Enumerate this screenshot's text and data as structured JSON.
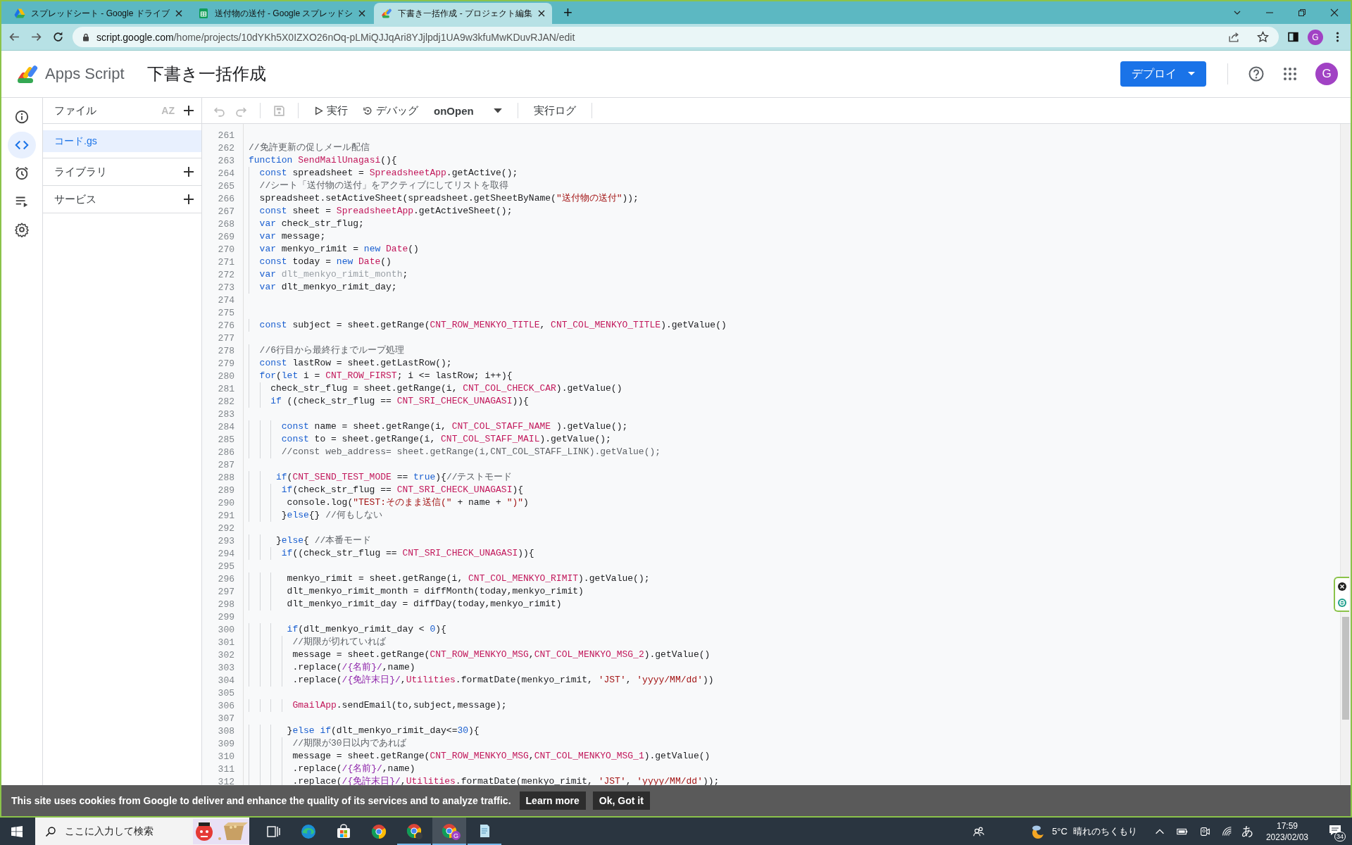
{
  "browser": {
    "tabs": [
      {
        "kind": "drive",
        "title": "スプレッドシート - Google ドライブ",
        "selected": false
      },
      {
        "kind": "sheets",
        "title": "送付物の送付 - Google スプレッドシ",
        "selected": false
      },
      {
        "kind": "apps-script",
        "title": "下書き一括作成 - プロジェクト編集",
        "selected": true
      }
    ],
    "new_tab": "+",
    "address": {
      "host": "script.google.com",
      "path": "/home/projects/10dYKh5X0IZXO26nOq-pLMiQJJqAri8YJjlpdj1UA9w3kfuMwKDuvRJAN/edit"
    },
    "profile": "G"
  },
  "header": {
    "product": "Apps Script",
    "project_title": "下書き一括作成",
    "deploy_button": "デプロイ",
    "avatar": "G"
  },
  "rail": [
    {
      "kind": "info",
      "selected": false
    },
    {
      "kind": "code",
      "selected": true
    },
    {
      "kind": "triggers",
      "selected": false
    },
    {
      "kind": "executions",
      "selected": false
    },
    {
      "kind": "settings",
      "selected": false
    }
  ],
  "files_panel": {
    "title": "ファイル",
    "sort": "AZ",
    "files": [
      {
        "name": "コード.gs",
        "selected": true
      }
    ],
    "sections": [
      "ライブラリ",
      "サービス"
    ]
  },
  "toolbar": {
    "run": "実行",
    "debug": "デバッグ",
    "function": "onOpen",
    "log": "実行ログ"
  },
  "editor": {
    "lines": [
      {
        "n": "261"
      },
      {
        "n": "262",
        "code": [
          {
            "kind": "comment",
            "text": "//免許更新の促しメール配信"
          }
        ]
      },
      {
        "n": "263",
        "code": [
          {
            "kind": "keyword",
            "text": "function"
          },
          {
            "kind": "identifier",
            "text": " SendMailUnagasi"
          },
          {
            "kind": "plain",
            "text": "(){"
          }
        ]
      },
      {
        "n": "264",
        "code": [
          {
            "kind": "keyword",
            "text": "  const"
          },
          {
            "kind": "plain",
            "text": " spreadsheet = "
          },
          {
            "kind": "identifier",
            "text": "SpreadsheetApp"
          },
          {
            "kind": "plain",
            "text": ".getActive();"
          }
        ]
      },
      {
        "n": "265",
        "code": [
          {
            "kind": "comment",
            "text": "  //シート「送付物の送付」をアクティブにしてリストを取得"
          }
        ]
      },
      {
        "n": "266",
        "code": [
          {
            "kind": "plain",
            "text": "  spreadsheet.setActiveSheet(spreadsheet.getSheetByName("
          },
          {
            "kind": "string",
            "text": "\"送付物の送付\""
          },
          {
            "kind": "plain",
            "text": "));"
          }
        ]
      },
      {
        "n": "267",
        "code": [
          {
            "kind": "keyword",
            "text": "  const"
          },
          {
            "kind": "plain",
            "text": " sheet = "
          },
          {
            "kind": "identifier",
            "text": "SpreadsheetApp"
          },
          {
            "kind": "plain",
            "text": ".getActiveSheet();"
          }
        ]
      },
      {
        "n": "268",
        "code": [
          {
            "kind": "keyword",
            "text": "  var"
          },
          {
            "kind": "plain",
            "text": " check_str_flug;"
          }
        ]
      },
      {
        "n": "269",
        "code": [
          {
            "kind": "keyword",
            "text": "  var"
          },
          {
            "kind": "plain",
            "text": " message;"
          }
        ]
      },
      {
        "n": "270",
        "code": [
          {
            "kind": "keyword",
            "text": "  var"
          },
          {
            "kind": "plain",
            "text": " menkyo_rimit = "
          },
          {
            "kind": "keyword",
            "text": "new"
          },
          {
            "kind": "identifier",
            "text": " Date"
          },
          {
            "kind": "plain",
            "text": "()"
          }
        ]
      },
      {
        "n": "271",
        "code": [
          {
            "kind": "keyword",
            "text": "  const"
          },
          {
            "kind": "plain",
            "text": " today = "
          },
          {
            "kind": "keyword",
            "text": "new"
          },
          {
            "kind": "identifier",
            "text": " Date"
          },
          {
            "kind": "plain",
            "text": "()"
          }
        ]
      },
      {
        "n": "272",
        "code": [
          {
            "kind": "keyword",
            "text": "  var"
          },
          {
            "kind": "unused",
            "text": " dlt_menkyo_rimit_month"
          },
          {
            "kind": "plain",
            "text": ";"
          }
        ]
      },
      {
        "n": "273",
        "code": [
          {
            "kind": "keyword",
            "text": "  var"
          },
          {
            "kind": "plain",
            "text": " dlt_menkyo_rimit_day;"
          }
        ]
      },
      {
        "n": "274"
      },
      {
        "n": "275"
      },
      {
        "n": "276",
        "code": [
          {
            "kind": "keyword",
            "text": "  const"
          },
          {
            "kind": "plain",
            "text": " subject = sheet.getRange("
          },
          {
            "kind": "identifier",
            "text": "CNT_ROW_MENKYO_TITLE"
          },
          {
            "kind": "plain",
            "text": ", "
          },
          {
            "kind": "identifier",
            "text": "CNT_COL_MENKYO_TITLE"
          },
          {
            "kind": "plain",
            "text": ").getValue()"
          }
        ]
      },
      {
        "n": "277"
      },
      {
        "n": "278",
        "code": [
          {
            "kind": "comment",
            "text": "  //6行目から最終行までループ処理"
          }
        ]
      },
      {
        "n": "279",
        "code": [
          {
            "kind": "keyword",
            "text": "  const"
          },
          {
            "kind": "plain",
            "text": " lastRow = sheet.getLastRow();"
          }
        ]
      },
      {
        "n": "280",
        "code": [
          {
            "kind": "keyword",
            "text": "  for"
          },
          {
            "kind": "plain",
            "text": "("
          },
          {
            "kind": "keyword",
            "text": "let"
          },
          {
            "kind": "plain",
            "text": " i = "
          },
          {
            "kind": "identifier",
            "text": "CNT_ROW_FIRST"
          },
          {
            "kind": "plain",
            "text": "; i <= lastRow; i++){"
          }
        ]
      },
      {
        "n": "281",
        "code": [
          {
            "kind": "plain",
            "text": "    check_str_flug = sheet.getRange(i, "
          },
          {
            "kind": "identifier",
            "text": "CNT_COL_CHECK_CAR"
          },
          {
            "kind": "plain",
            "text": ").getValue()"
          }
        ]
      },
      {
        "n": "282",
        "code": [
          {
            "kind": "keyword",
            "text": "    if"
          },
          {
            "kind": "plain",
            "text": " ((check_str_flug == "
          },
          {
            "kind": "identifier",
            "text": "CNT_SRI_CHECK_UNAGASI"
          },
          {
            "kind": "plain",
            "text": ")){"
          }
        ]
      },
      {
        "n": "283"
      },
      {
        "n": "284",
        "code": [
          {
            "kind": "keyword",
            "text": "      const"
          },
          {
            "kind": "plain",
            "text": " name = sheet.getRange(i, "
          },
          {
            "kind": "identifier",
            "text": "CNT_COL_STAFF_NAME"
          },
          {
            "kind": "plain",
            "text": " ).getValue();"
          }
        ]
      },
      {
        "n": "285",
        "code": [
          {
            "kind": "keyword",
            "text": "      const"
          },
          {
            "kind": "plain",
            "text": " to = sheet.getRange(i, "
          },
          {
            "kind": "identifier",
            "text": "CNT_COL_STAFF_MAIL"
          },
          {
            "kind": "plain",
            "text": ").getValue();"
          }
        ]
      },
      {
        "n": "286",
        "code": [
          {
            "kind": "comment",
            "text": "      //const web_address= sheet.getRange(i,CNT_COL_STAFF_LINK).getValue();"
          }
        ]
      },
      {
        "n": "287"
      },
      {
        "n": "288",
        "code": [
          {
            "kind": "keyword",
            "text": "     if"
          },
          {
            "kind": "plain",
            "text": "("
          },
          {
            "kind": "identifier",
            "text": "CNT_SEND_TEST_MODE"
          },
          {
            "kind": "plain",
            "text": " == "
          },
          {
            "kind": "keyword",
            "text": "true"
          },
          {
            "kind": "plain",
            "text": "){"
          },
          {
            "kind": "comment",
            "text": "//テストモード"
          }
        ]
      },
      {
        "n": "289",
        "code": [
          {
            "kind": "keyword",
            "text": "      if"
          },
          {
            "kind": "plain",
            "text": "(check_str_flug == "
          },
          {
            "kind": "identifier",
            "text": "CNT_SRI_CHECK_UNAGASI"
          },
          {
            "kind": "plain",
            "text": "){"
          }
        ]
      },
      {
        "n": "290",
        "code": [
          {
            "kind": "plain",
            "text": "       console.log("
          },
          {
            "kind": "string",
            "text": "\"TEST:そのまま送信(\""
          },
          {
            "kind": "plain",
            "text": " + name + "
          },
          {
            "kind": "string",
            "text": "\")\""
          },
          {
            "kind": "plain",
            "text": ")"
          }
        ]
      },
      {
        "n": "291",
        "code": [
          {
            "kind": "plain",
            "text": "      }"
          },
          {
            "kind": "keyword",
            "text": "else"
          },
          {
            "kind": "plain",
            "text": "{} "
          },
          {
            "kind": "comment",
            "text": "//何もしない"
          }
        ]
      },
      {
        "n": "292"
      },
      {
        "n": "293",
        "code": [
          {
            "kind": "plain",
            "text": "     }"
          },
          {
            "kind": "keyword",
            "text": "else"
          },
          {
            "kind": "plain",
            "text": "{ "
          },
          {
            "kind": "comment",
            "text": "//本番モード"
          }
        ]
      },
      {
        "n": "294",
        "code": [
          {
            "kind": "keyword",
            "text": "      if"
          },
          {
            "kind": "plain",
            "text": "((check_str_flug == "
          },
          {
            "kind": "identifier",
            "text": "CNT_SRI_CHECK_UNAGASI"
          },
          {
            "kind": "plain",
            "text": ")){"
          }
        ]
      },
      {
        "n": "295"
      },
      {
        "n": "296",
        "code": [
          {
            "kind": "plain",
            "text": "       menkyo_rimit = sheet.getRange(i, "
          },
          {
            "kind": "identifier",
            "text": "CNT_COL_MENKYO_RIMIT"
          },
          {
            "kind": "plain",
            "text": ").getValue();"
          }
        ]
      },
      {
        "n": "297",
        "code": [
          {
            "kind": "plain",
            "text": "       dlt_menkyo_rimit_month = diffMonth(today,menkyo_rimit)"
          }
        ]
      },
      {
        "n": "298",
        "code": [
          {
            "kind": "plain",
            "text": "       dlt_menkyo_rimit_day = diffDay(today,menkyo_rimit)"
          }
        ]
      },
      {
        "n": "299"
      },
      {
        "n": "300",
        "code": [
          {
            "kind": "keyword",
            "text": "       if"
          },
          {
            "kind": "plain",
            "text": "(dlt_menkyo_rimit_day < "
          },
          {
            "kind": "number",
            "text": "0"
          },
          {
            "kind": "plain",
            "text": "){"
          }
        ]
      },
      {
        "n": "301",
        "code": [
          {
            "kind": "comment",
            "text": "        //期限が切れていれば"
          }
        ]
      },
      {
        "n": "302",
        "code": [
          {
            "kind": "plain",
            "text": "        message = sheet.getRange("
          },
          {
            "kind": "identifier",
            "text": "CNT_ROW_MENKYO_MSG"
          },
          {
            "kind": "plain",
            "text": ","
          },
          {
            "kind": "identifier",
            "text": "CNT_COL_MENKYO_MSG_2"
          },
          {
            "kind": "plain",
            "text": ").getValue()"
          }
        ]
      },
      {
        "n": "303",
        "code": [
          {
            "kind": "plain",
            "text": "        .replace("
          },
          {
            "kind": "regex",
            "text": "/{名前}/"
          },
          {
            "kind": "plain",
            "text": ",name)"
          }
        ]
      },
      {
        "n": "304",
        "code": [
          {
            "kind": "plain",
            "text": "        .replace("
          },
          {
            "kind": "regex",
            "text": "/{免許末日}/"
          },
          {
            "kind": "plain",
            "text": ","
          },
          {
            "kind": "identifier",
            "text": "Utilities"
          },
          {
            "kind": "plain",
            "text": ".formatDate(menkyo_rimit, "
          },
          {
            "kind": "string",
            "text": "'JST'"
          },
          {
            "kind": "plain",
            "text": ", "
          },
          {
            "kind": "string",
            "text": "'yyyy/MM/dd'"
          },
          {
            "kind": "plain",
            "text": "))"
          }
        ]
      },
      {
        "n": "305"
      },
      {
        "n": "306",
        "code": [
          {
            "kind": "identifier",
            "text": "        GmailApp"
          },
          {
            "kind": "plain",
            "text": ".sendEmail(to,subject,message);"
          }
        ]
      },
      {
        "n": "307"
      },
      {
        "n": "308",
        "code": [
          {
            "kind": "plain",
            "text": "       }"
          },
          {
            "kind": "keyword",
            "text": "else if"
          },
          {
            "kind": "plain",
            "text": "(dlt_menkyo_rimit_day<="
          },
          {
            "kind": "number",
            "text": "30"
          },
          {
            "kind": "plain",
            "text": "){"
          }
        ]
      },
      {
        "n": "309",
        "code": [
          {
            "kind": "comment",
            "text": "        //期限が30日以内であれば"
          }
        ]
      },
      {
        "n": "310",
        "code": [
          {
            "kind": "plain",
            "text": "        message = sheet.getRange("
          },
          {
            "kind": "identifier",
            "text": "CNT_ROW_MENKYO_MSG"
          },
          {
            "kind": "plain",
            "text": ","
          },
          {
            "kind": "identifier",
            "text": "CNT_COL_MENKYO_MSG_1"
          },
          {
            "kind": "plain",
            "text": ").getValue()"
          }
        ]
      },
      {
        "n": "311",
        "code": [
          {
            "kind": "plain",
            "text": "        .replace("
          },
          {
            "kind": "regex",
            "text": "/{名前}/"
          },
          {
            "kind": "plain",
            "text": ",name)"
          }
        ]
      },
      {
        "n": "312",
        "code": [
          {
            "kind": "plain",
            "text": "        .replace("
          },
          {
            "kind": "regex",
            "text": "/{免許末日}/"
          },
          {
            "kind": "plain",
            "text": ","
          },
          {
            "kind": "identifier",
            "text": "Utilities"
          },
          {
            "kind": "plain",
            "text": ".formatDate(menkyo_rimit, "
          },
          {
            "kind": "string",
            "text": "'JST'"
          },
          {
            "kind": "plain",
            "text": ", "
          },
          {
            "kind": "string",
            "text": "'yyyy/MM/dd'"
          },
          {
            "kind": "plain",
            "text": "));"
          }
        ]
      }
    ]
  },
  "cookie_bar": {
    "message": "This site uses cookies from Google to deliver and enhance the quality of its services and to analyze traffic.",
    "buttons": [
      "Learn more",
      "Ok, Got it"
    ]
  },
  "taskbar": {
    "search_placeholder": "ここに入力して検索",
    "apps": [
      {
        "kind": "taskview",
        "running": false,
        "selected": false
      },
      {
        "kind": "edge",
        "running": false,
        "selected": false
      },
      {
        "kind": "store",
        "running": false,
        "selected": false
      },
      {
        "kind": "chrome",
        "running": false,
        "selected": false
      },
      {
        "kind": "chrome-profile",
        "running": true,
        "selected": false
      },
      {
        "kind": "chrome-g",
        "badge": "G",
        "running": true,
        "selected": true
      },
      {
        "kind": "notepad",
        "running": true,
        "selected": false
      }
    ],
    "weather": {
      "temp": "5°C",
      "text": "晴れのちくもり"
    },
    "ime": "あ",
    "time": "17:59",
    "date": "2023/02/03",
    "notifications": "34"
  }
}
